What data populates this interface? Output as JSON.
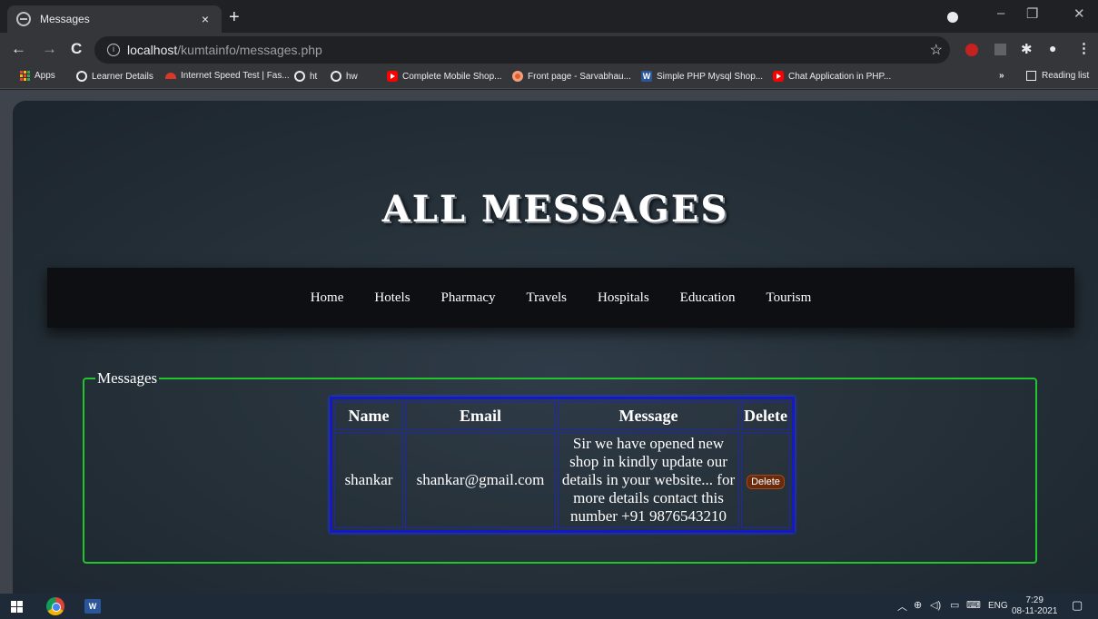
{
  "browser": {
    "tab_title": "Messages",
    "tab_close": "×",
    "new_tab": "+",
    "url_host": "localhost",
    "url_path": "/kumtainfo/messages.php",
    "bookmarks": [
      {
        "label": "Apps",
        "icon": "apps-grid-icon"
      },
      {
        "label": "Learner Details",
        "icon": "globe-icon"
      },
      {
        "label": "Internet Speed Test | Fas...",
        "icon": "speed-icon"
      },
      {
        "label": "ht",
        "icon": "globe-icon"
      },
      {
        "label": "hw",
        "icon": "globe-icon"
      },
      {
        "label": "Complete Mobile Shop...",
        "icon": "youtube-icon"
      },
      {
        "label": "Front page - Sarvabhau...",
        "icon": "site-icon"
      },
      {
        "label": "Simple PHP Mysql Shop...",
        "icon": "word-icon"
      },
      {
        "label": "Chat Application in PHP...",
        "icon": "youtube-icon"
      }
    ],
    "more_bookmarks": "»",
    "reading_list": "Reading list"
  },
  "page": {
    "title": "ALL MESSAGES",
    "nav": [
      "Home",
      "Hotels",
      "Pharmacy",
      "Travels",
      "Hospitals",
      "Education",
      "Tourism"
    ],
    "legend": "Messages",
    "table": {
      "headers": [
        "Name",
        "Email",
        "Message",
        "Delete"
      ],
      "rows": [
        {
          "name": "shankar",
          "email": "shankar@gmail.com",
          "message": "Sir we have opened new shop in kindly update our details in your website... for more details contact this number +91 9876543210",
          "delete_label": "Delete"
        }
      ]
    }
  },
  "taskbar": {
    "language": "ENG",
    "time": "7:29",
    "date": "08-11-2021"
  },
  "colors": {
    "fieldset_border": "#22c52e",
    "table_border": "#1418c8",
    "delete_button": "#6b2a0c"
  }
}
